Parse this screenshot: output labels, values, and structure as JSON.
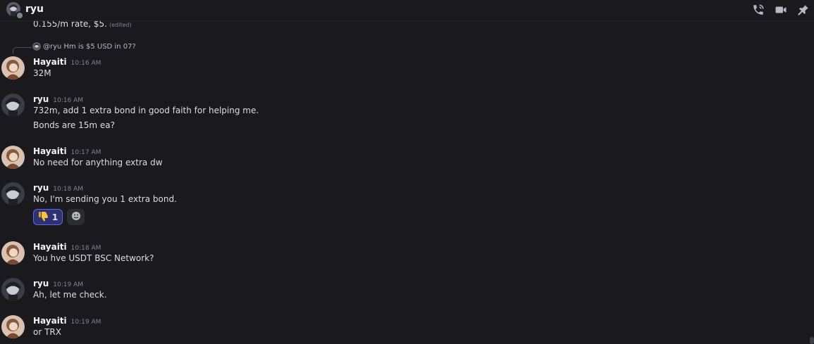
{
  "header": {
    "title": "ryu",
    "icons": [
      "voice-call-icon",
      "video-call-icon",
      "pin-icon"
    ]
  },
  "partial_message": {
    "text": "0.155/m rate, $5.",
    "edited": "(edited)"
  },
  "reply": {
    "mention": "@ryu",
    "text": "Hm is $5 USD in 07?"
  },
  "messages": [
    {
      "author": "Hayaiti",
      "time": "10:16 AM",
      "lines": [
        "32M"
      ]
    },
    {
      "author": "ryu",
      "time": "10:16 AM",
      "lines": [
        "732m, add 1 extra bond in good faith for helping me.",
        "Bonds are 15m ea?"
      ]
    },
    {
      "author": "Hayaiti",
      "time": "10:17 AM",
      "lines": [
        "No need for anything extra dw"
      ]
    },
    {
      "author": "ryu",
      "time": "10:18 AM",
      "lines": [
        "No, I'm sending you 1 extra bond."
      ],
      "reaction": {
        "emoji": "thumbs-down-icon",
        "count": "1"
      }
    },
    {
      "author": "Hayaiti",
      "time": "10:18 AM",
      "lines": [
        "You hve USDT BSC Network?"
      ]
    },
    {
      "author": "ryu",
      "time": "10:19 AM",
      "lines": [
        "Ah, let me check."
      ]
    },
    {
      "author": "Hayaiti",
      "time": "10:19 AM",
      "lines": [
        "or TRX"
      ]
    }
  ],
  "colors": {
    "background": "#1a1a1e",
    "reaction_accent": "#5865f2",
    "reaction_bg": "#2f3270"
  }
}
